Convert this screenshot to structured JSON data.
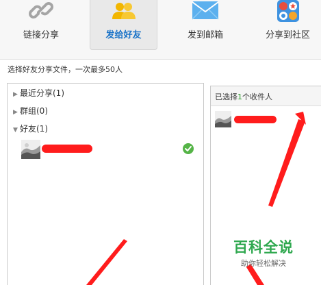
{
  "tabs": [
    {
      "label": "链接分享",
      "icon": "link-icon",
      "active": false
    },
    {
      "label": "发给好友",
      "icon": "friends-icon",
      "active": true
    },
    {
      "label": "发到邮箱",
      "icon": "mail-icon",
      "active": false
    },
    {
      "label": "分享到社区",
      "icon": "community-icon",
      "active": false
    }
  ],
  "hint": "选择好友分享文件，一次最多50人",
  "groups": [
    {
      "label": "最近分享(1)",
      "expanded": false
    },
    {
      "label": "群组(0)",
      "expanded": false
    },
    {
      "label": "好友(1)",
      "expanded": true
    }
  ],
  "selected": {
    "prefix": "已选择",
    "count": "1",
    "suffix": "个收件人"
  },
  "watermark": {
    "main": "百科全说",
    "sub": "助你轻松解决"
  },
  "colors": {
    "accent": "#1a73c8",
    "check": "#55b447",
    "annotation": "#ff1c1c",
    "watermark": "#2fa84f"
  }
}
